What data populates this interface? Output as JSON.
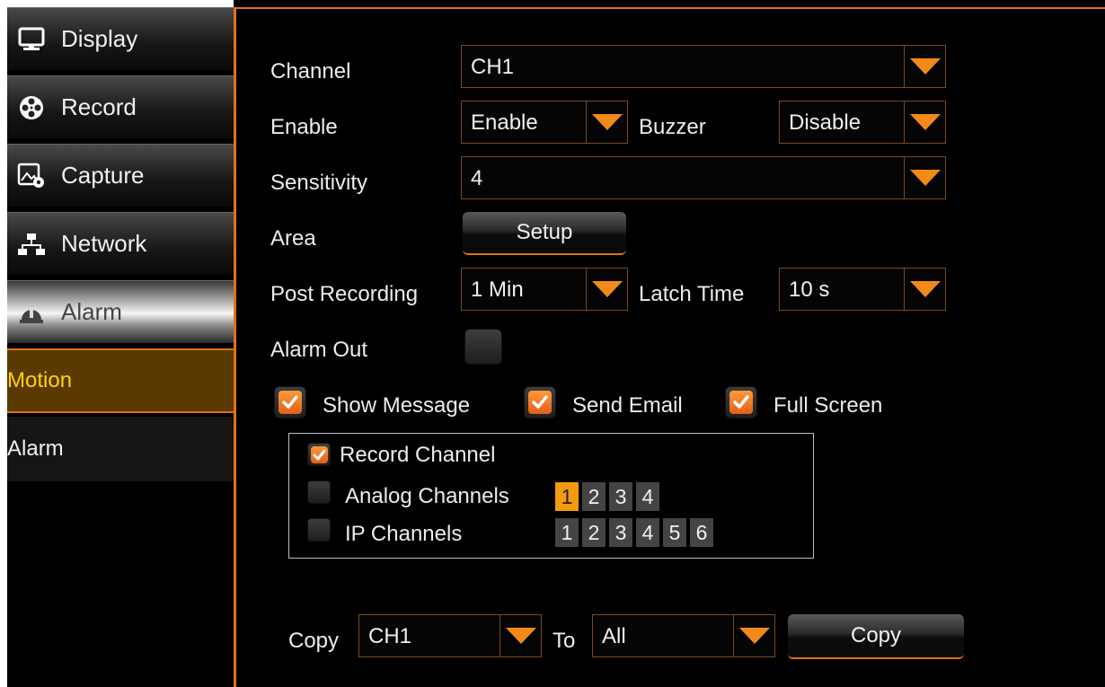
{
  "sidebar": {
    "menu": [
      {
        "label": "Display",
        "icon": "monitor-icon"
      },
      {
        "label": "Record",
        "icon": "film-reel-icon"
      },
      {
        "label": "Capture",
        "icon": "image-gear-icon"
      },
      {
        "label": "Network",
        "icon": "network-icon"
      },
      {
        "label": "Alarm",
        "icon": "alarm-bell-icon",
        "active": true
      }
    ],
    "submenu": [
      {
        "label": "Motion",
        "selected": true
      },
      {
        "label": "Alarm",
        "selected": false
      }
    ]
  },
  "form": {
    "channel": {
      "label": "Channel",
      "value": "CH1"
    },
    "enable": {
      "label": "Enable",
      "value": "Enable"
    },
    "buzzer": {
      "label": "Buzzer",
      "value": "Disable"
    },
    "sensitivity": {
      "label": "Sensitivity",
      "value": "4"
    },
    "area": {
      "label": "Area",
      "button": "Setup"
    },
    "post_recording": {
      "label": "Post Recording",
      "value": "1 Min"
    },
    "latch_time": {
      "label": "Latch Time",
      "value": "10 s"
    },
    "alarm_out": {
      "label": "Alarm Out",
      "checked": false
    },
    "show_message": {
      "label": "Show Message",
      "checked": true
    },
    "send_email": {
      "label": "Send Email",
      "checked": true
    },
    "full_screen": {
      "label": "Full Screen",
      "checked": true
    }
  },
  "record_group": {
    "record_channel": {
      "label": "Record Channel",
      "checked": true
    },
    "analog": {
      "label": "Analog Channels",
      "checked": false,
      "channels": [
        "1",
        "2",
        "3",
        "4"
      ],
      "selected": [
        "1"
      ]
    },
    "ip": {
      "label": "IP Channels",
      "checked": false,
      "channels": [
        "1",
        "2",
        "3",
        "4",
        "5",
        "6"
      ],
      "selected": []
    }
  },
  "copy": {
    "label": "Copy",
    "from": "CH1",
    "to_label": "To",
    "to": "All",
    "button": "Copy"
  },
  "colors": {
    "accent": "#e2701a",
    "selected_channel": "#f49a10",
    "highlight_text": "#ffd01a"
  }
}
